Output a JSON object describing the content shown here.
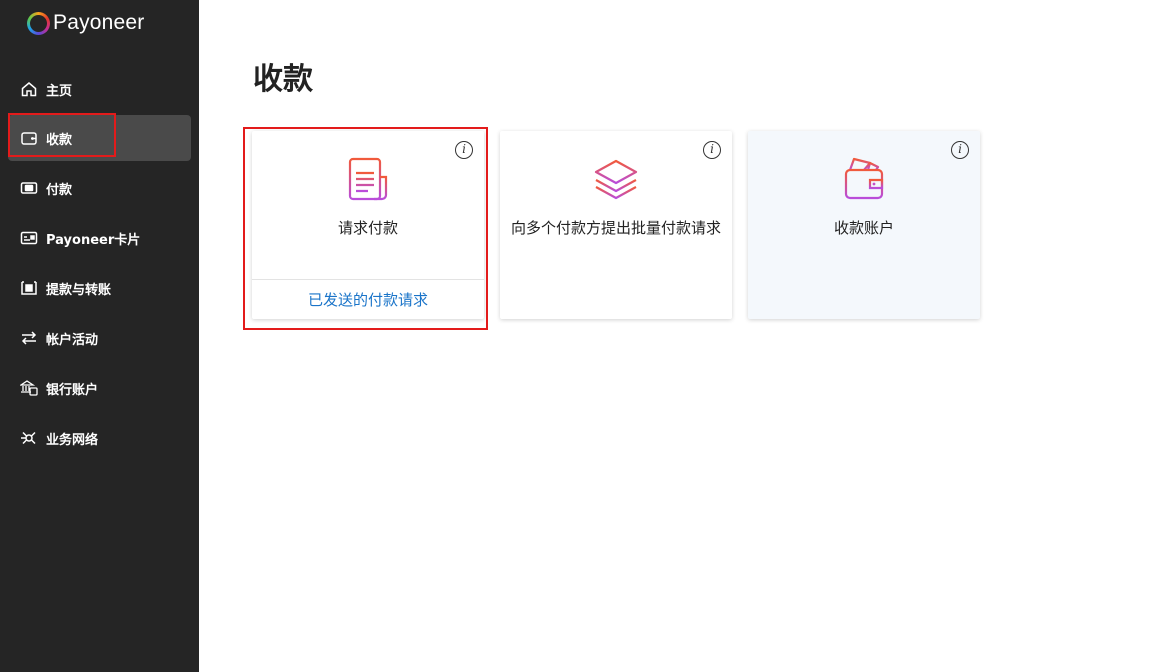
{
  "brand": {
    "name": "Payoneer"
  },
  "sidebar": {
    "items": [
      {
        "label": "主页",
        "icon": "home-icon"
      },
      {
        "label": "收款",
        "icon": "wallet-icon",
        "active": true
      },
      {
        "label": "付款",
        "icon": "money-icon"
      },
      {
        "label": "Payoneer卡片",
        "icon": "card-icon"
      },
      {
        "label": "提款与转账",
        "icon": "withdraw-icon"
      },
      {
        "label": "帐户活动",
        "icon": "transfer-arrows-icon"
      },
      {
        "label": "银行账户",
        "icon": "bank-icon"
      },
      {
        "label": "业务网络",
        "icon": "network-icon"
      }
    ]
  },
  "main": {
    "title": "收款",
    "cards": [
      {
        "title": "请求付款",
        "link": "已发送的付款请求",
        "icon": "invoice-icon",
        "info": "i"
      },
      {
        "title": "向多个付款方提出批量付款请求",
        "icon": "layers-icon",
        "info": "i"
      },
      {
        "title": "收款账户",
        "icon": "wallet-cash-icon",
        "info": "i"
      }
    ]
  },
  "colors": {
    "sidebar_bg": "#252525",
    "active_bg": "#4a4a4a",
    "link": "#1a74c9",
    "highlight": "#e31b1b",
    "icon_gradient_start": "#f15a3b",
    "icon_gradient_end": "#b94ddb"
  }
}
